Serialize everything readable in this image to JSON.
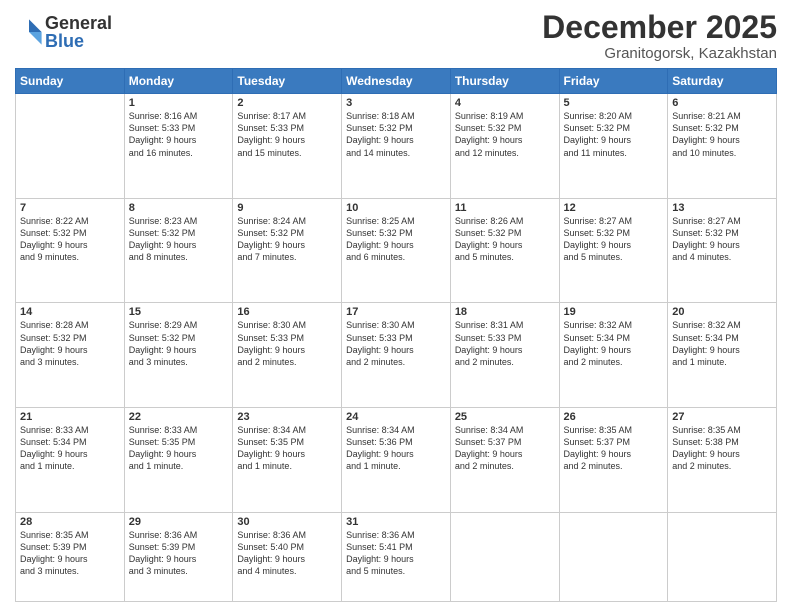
{
  "logo": {
    "general": "General",
    "blue": "Blue"
  },
  "title": "December 2025",
  "location": "Granitogorsk, Kazakhstan",
  "days_header": [
    "Sunday",
    "Monday",
    "Tuesday",
    "Wednesday",
    "Thursday",
    "Friday",
    "Saturday"
  ],
  "weeks": [
    [
      {
        "day": "",
        "info": ""
      },
      {
        "day": "1",
        "info": "Sunrise: 8:16 AM\nSunset: 5:33 PM\nDaylight: 9 hours\nand 16 minutes."
      },
      {
        "day": "2",
        "info": "Sunrise: 8:17 AM\nSunset: 5:33 PM\nDaylight: 9 hours\nand 15 minutes."
      },
      {
        "day": "3",
        "info": "Sunrise: 8:18 AM\nSunset: 5:32 PM\nDaylight: 9 hours\nand 14 minutes."
      },
      {
        "day": "4",
        "info": "Sunrise: 8:19 AM\nSunset: 5:32 PM\nDaylight: 9 hours\nand 12 minutes."
      },
      {
        "day": "5",
        "info": "Sunrise: 8:20 AM\nSunset: 5:32 PM\nDaylight: 9 hours\nand 11 minutes."
      },
      {
        "day": "6",
        "info": "Sunrise: 8:21 AM\nSunset: 5:32 PM\nDaylight: 9 hours\nand 10 minutes."
      }
    ],
    [
      {
        "day": "7",
        "info": "Sunrise: 8:22 AM\nSunset: 5:32 PM\nDaylight: 9 hours\nand 9 minutes."
      },
      {
        "day": "8",
        "info": "Sunrise: 8:23 AM\nSunset: 5:32 PM\nDaylight: 9 hours\nand 8 minutes."
      },
      {
        "day": "9",
        "info": "Sunrise: 8:24 AM\nSunset: 5:32 PM\nDaylight: 9 hours\nand 7 minutes."
      },
      {
        "day": "10",
        "info": "Sunrise: 8:25 AM\nSunset: 5:32 PM\nDaylight: 9 hours\nand 6 minutes."
      },
      {
        "day": "11",
        "info": "Sunrise: 8:26 AM\nSunset: 5:32 PM\nDaylight: 9 hours\nand 5 minutes."
      },
      {
        "day": "12",
        "info": "Sunrise: 8:27 AM\nSunset: 5:32 PM\nDaylight: 9 hours\nand 5 minutes."
      },
      {
        "day": "13",
        "info": "Sunrise: 8:27 AM\nSunset: 5:32 PM\nDaylight: 9 hours\nand 4 minutes."
      }
    ],
    [
      {
        "day": "14",
        "info": "Sunrise: 8:28 AM\nSunset: 5:32 PM\nDaylight: 9 hours\nand 3 minutes."
      },
      {
        "day": "15",
        "info": "Sunrise: 8:29 AM\nSunset: 5:32 PM\nDaylight: 9 hours\nand 3 minutes."
      },
      {
        "day": "16",
        "info": "Sunrise: 8:30 AM\nSunset: 5:33 PM\nDaylight: 9 hours\nand 2 minutes."
      },
      {
        "day": "17",
        "info": "Sunrise: 8:30 AM\nSunset: 5:33 PM\nDaylight: 9 hours\nand 2 minutes."
      },
      {
        "day": "18",
        "info": "Sunrise: 8:31 AM\nSunset: 5:33 PM\nDaylight: 9 hours\nand 2 minutes."
      },
      {
        "day": "19",
        "info": "Sunrise: 8:32 AM\nSunset: 5:34 PM\nDaylight: 9 hours\nand 2 minutes."
      },
      {
        "day": "20",
        "info": "Sunrise: 8:32 AM\nSunset: 5:34 PM\nDaylight: 9 hours\nand 1 minute."
      }
    ],
    [
      {
        "day": "21",
        "info": "Sunrise: 8:33 AM\nSunset: 5:34 PM\nDaylight: 9 hours\nand 1 minute."
      },
      {
        "day": "22",
        "info": "Sunrise: 8:33 AM\nSunset: 5:35 PM\nDaylight: 9 hours\nand 1 minute."
      },
      {
        "day": "23",
        "info": "Sunrise: 8:34 AM\nSunset: 5:35 PM\nDaylight: 9 hours\nand 1 minute."
      },
      {
        "day": "24",
        "info": "Sunrise: 8:34 AM\nSunset: 5:36 PM\nDaylight: 9 hours\nand 1 minute."
      },
      {
        "day": "25",
        "info": "Sunrise: 8:34 AM\nSunset: 5:37 PM\nDaylight: 9 hours\nand 2 minutes."
      },
      {
        "day": "26",
        "info": "Sunrise: 8:35 AM\nSunset: 5:37 PM\nDaylight: 9 hours\nand 2 minutes."
      },
      {
        "day": "27",
        "info": "Sunrise: 8:35 AM\nSunset: 5:38 PM\nDaylight: 9 hours\nand 2 minutes."
      }
    ],
    [
      {
        "day": "28",
        "info": "Sunrise: 8:35 AM\nSunset: 5:39 PM\nDaylight: 9 hours\nand 3 minutes."
      },
      {
        "day": "29",
        "info": "Sunrise: 8:36 AM\nSunset: 5:39 PM\nDaylight: 9 hours\nand 3 minutes."
      },
      {
        "day": "30",
        "info": "Sunrise: 8:36 AM\nSunset: 5:40 PM\nDaylight: 9 hours\nand 4 minutes."
      },
      {
        "day": "31",
        "info": "Sunrise: 8:36 AM\nSunset: 5:41 PM\nDaylight: 9 hours\nand 5 minutes."
      },
      {
        "day": "",
        "info": ""
      },
      {
        "day": "",
        "info": ""
      },
      {
        "day": "",
        "info": ""
      }
    ]
  ]
}
